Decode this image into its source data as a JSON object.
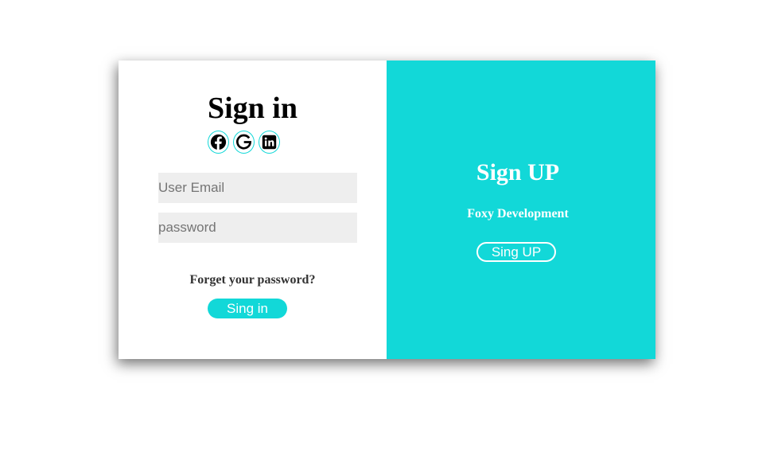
{
  "colors": {
    "accent": "#12d8d8",
    "field_background": "#eeeeee",
    "panel_white": "#ffffff"
  },
  "signin": {
    "title": "Sign in",
    "social_icons": [
      "facebook-icon",
      "google-icon",
      "linkedin-icon"
    ],
    "email_placeholder": "User Email",
    "password_placeholder": "password",
    "forgot_link": "Forget your password?",
    "button_label": "Sing in"
  },
  "signup": {
    "title": "Sign UP",
    "subtitle": "Foxy Development",
    "button_label": "Sing UP"
  }
}
